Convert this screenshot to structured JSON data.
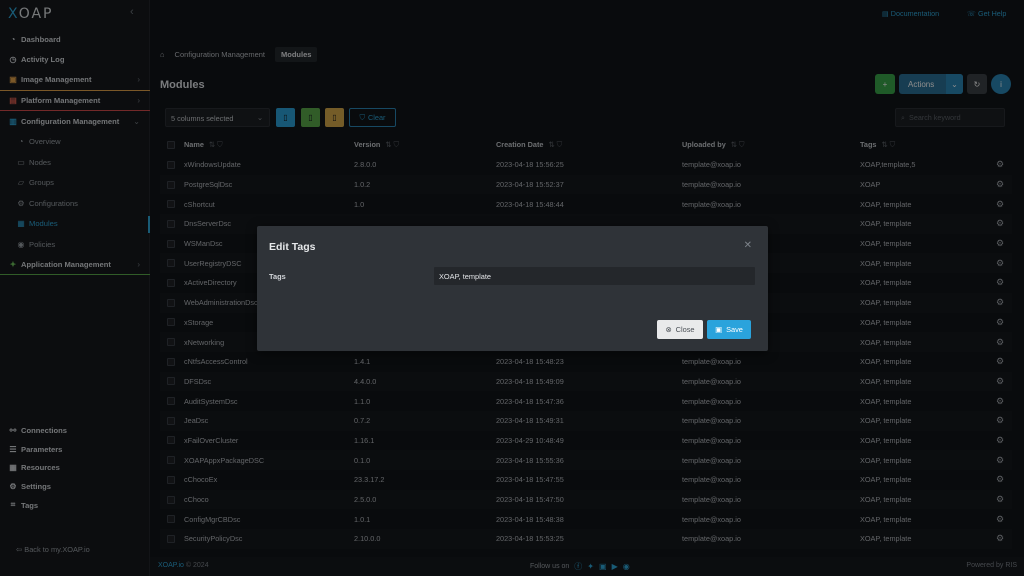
{
  "app": {
    "logo": "XOAP"
  },
  "topbar": {
    "documentation": "Documentation",
    "get_help": "Get Help"
  },
  "sidebar": {
    "items": [
      {
        "label": "Dashboard"
      },
      {
        "label": "Activity Log"
      },
      {
        "label": "Image Management"
      },
      {
        "label": "Platform Management"
      },
      {
        "label": "Configuration Management"
      },
      {
        "label": "Overview"
      },
      {
        "label": "Nodes"
      },
      {
        "label": "Groups"
      },
      {
        "label": "Configurations"
      },
      {
        "label": "Modules"
      },
      {
        "label": "Policies"
      },
      {
        "label": "Application Management"
      }
    ],
    "bottom_items": [
      {
        "label": "Connections"
      },
      {
        "label": "Parameters"
      },
      {
        "label": "Resources"
      },
      {
        "label": "Settings"
      },
      {
        "label": "Tags"
      }
    ],
    "back_link": "Back to my.XOAP.io"
  },
  "breadcrumb": {
    "items": [
      "Configuration Management",
      "Modules"
    ]
  },
  "page": {
    "title": "Modules"
  },
  "header_buttons": {
    "actions": "Actions"
  },
  "toolbar": {
    "columns_selected": "5 columns selected",
    "clear": "Clear",
    "search_placeholder": "Search keyword"
  },
  "table": {
    "columns": [
      "Name",
      "Version",
      "Creation Date",
      "Uploaded by",
      "Tags"
    ],
    "rows": [
      [
        "xWindowsUpdate",
        "2.8.0.0",
        "2023-04-18 15:56:25",
        "template@xoap.io",
        "XOAP,template,5"
      ],
      [
        "PostgreSqlDsc",
        "1.0.2",
        "2023-04-18 15:52:37",
        "template@xoap.io",
        "XOAP"
      ],
      [
        "cShortcut",
        "1.0",
        "2023-04-18 15:48:44",
        "template@xoap.io",
        "XOAP, template"
      ],
      [
        "DnsServerDsc",
        "",
        "",
        "",
        "XOAP, template"
      ],
      [
        "WSManDsc",
        "",
        "",
        "",
        "XOAP, template"
      ],
      [
        "UserRegistryDSC",
        "",
        "",
        "",
        "XOAP, template"
      ],
      [
        "xActiveDirectory",
        "",
        "",
        "",
        "XOAP, template"
      ],
      [
        "WebAdministrationDsc",
        "",
        "",
        "",
        "XOAP, template"
      ],
      [
        "xStorage",
        "",
        "",
        "",
        "XOAP, template"
      ],
      [
        "xNetworking",
        "",
        "",
        "",
        "XOAP, template"
      ],
      [
        "cNtfsAccessControl",
        "1.4.1",
        "2023-04-18 15:48:23",
        "template@xoap.io",
        "XOAP, template"
      ],
      [
        "DFSDsc",
        "4.4.0.0",
        "2023-04-18 15:49:09",
        "template@xoap.io",
        "XOAP, template"
      ],
      [
        "AuditSystemDsc",
        "1.1.0",
        "2023-04-18 15:47:36",
        "template@xoap.io",
        "XOAP, template"
      ],
      [
        "JeaDsc",
        "0.7.2",
        "2023-04-18 15:49:31",
        "template@xoap.io",
        "XOAP, template"
      ],
      [
        "xFailOverCluster",
        "1.16.1",
        "2023-04-29 10:48:49",
        "template@xoap.io",
        "XOAP, template"
      ],
      [
        "XOAPAppxPackageDSC",
        "0.1.0",
        "2023-04-18 15:55:36",
        "template@xoap.io",
        "XOAP, template"
      ],
      [
        "cChocoEx",
        "23.3.17.2",
        "2023-04-18 15:47:55",
        "template@xoap.io",
        "XOAP, template"
      ],
      [
        "cChoco",
        "2.5.0.0",
        "2023-04-18 15:47:50",
        "template@xoap.io",
        "XOAP, template"
      ],
      [
        "ConfigMgrCBDsc",
        "1.0.1",
        "2023-04-18 15:48:38",
        "template@xoap.io",
        "XOAP, template"
      ],
      [
        "SecurityPolicyDsc",
        "2.10.0.0",
        "2023-04-18 15:53:25",
        "template@xoap.io",
        "XOAP, template"
      ]
    ]
  },
  "footer": {
    "copyright_brand": "XOAP.io",
    "copyright_year": "© 2024",
    "follow": "Follow us on",
    "powered": "Powered by RIS"
  },
  "modal": {
    "title": "Edit Tags",
    "tags_label": "Tags",
    "tags_value": "XOAP, template",
    "close_label": "Close",
    "save_label": "Save"
  },
  "colors": {
    "accent": "#2fa6d8",
    "success": "#3aa44a",
    "warning": "#d4a84a",
    "background": "#111418"
  }
}
